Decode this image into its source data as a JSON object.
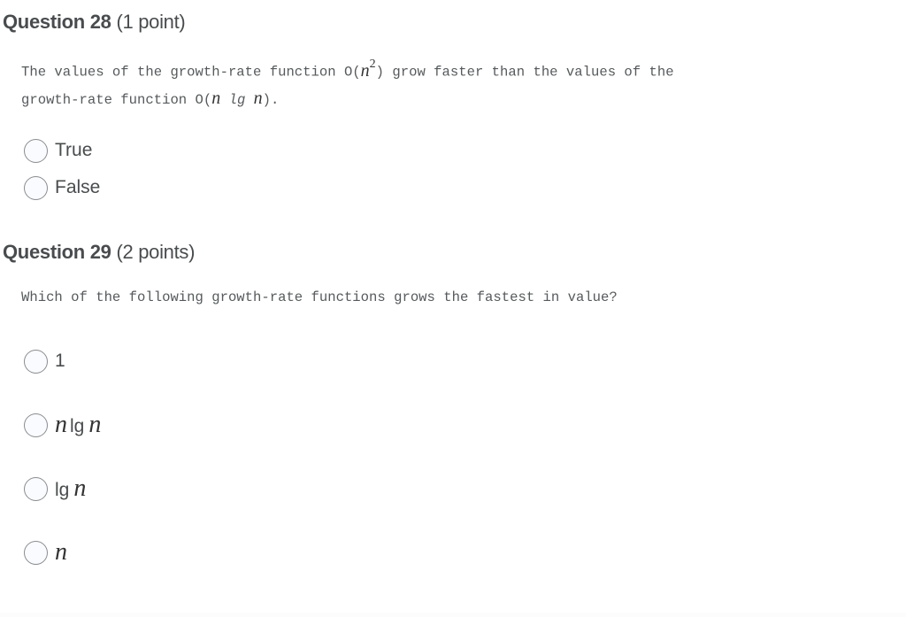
{
  "questions": [
    {
      "number_label": "Question 28",
      "points_label": "(1 point)",
      "text_parts": {
        "before_math1": "The values of the growth-rate function O(",
        "math1_base": "n",
        "math1_sup": "2",
        "after_math1_line1": ") grow faster than the values of the",
        "line2_before": "growth-rate function O(",
        "math2_a": "n",
        "math2_mid": " lg ",
        "math2_b": "n",
        "line2_after": ")."
      },
      "options": [
        {
          "label": "True",
          "selected": false
        },
        {
          "label": "False",
          "selected": false
        }
      ]
    },
    {
      "number_label": "Question 29",
      "points_label": "(2 points)",
      "text": "Which of the following growth-rate functions grows the fastest in value?",
      "options": [
        {
          "label": "1",
          "selected": false
        },
        {
          "math_a": "n",
          "text": "lg",
          "math_b": "n",
          "selected": false
        },
        {
          "text": "lg",
          "math_b": "n",
          "selected": false
        },
        {
          "math_a": "n",
          "selected": false
        }
      ]
    }
  ]
}
